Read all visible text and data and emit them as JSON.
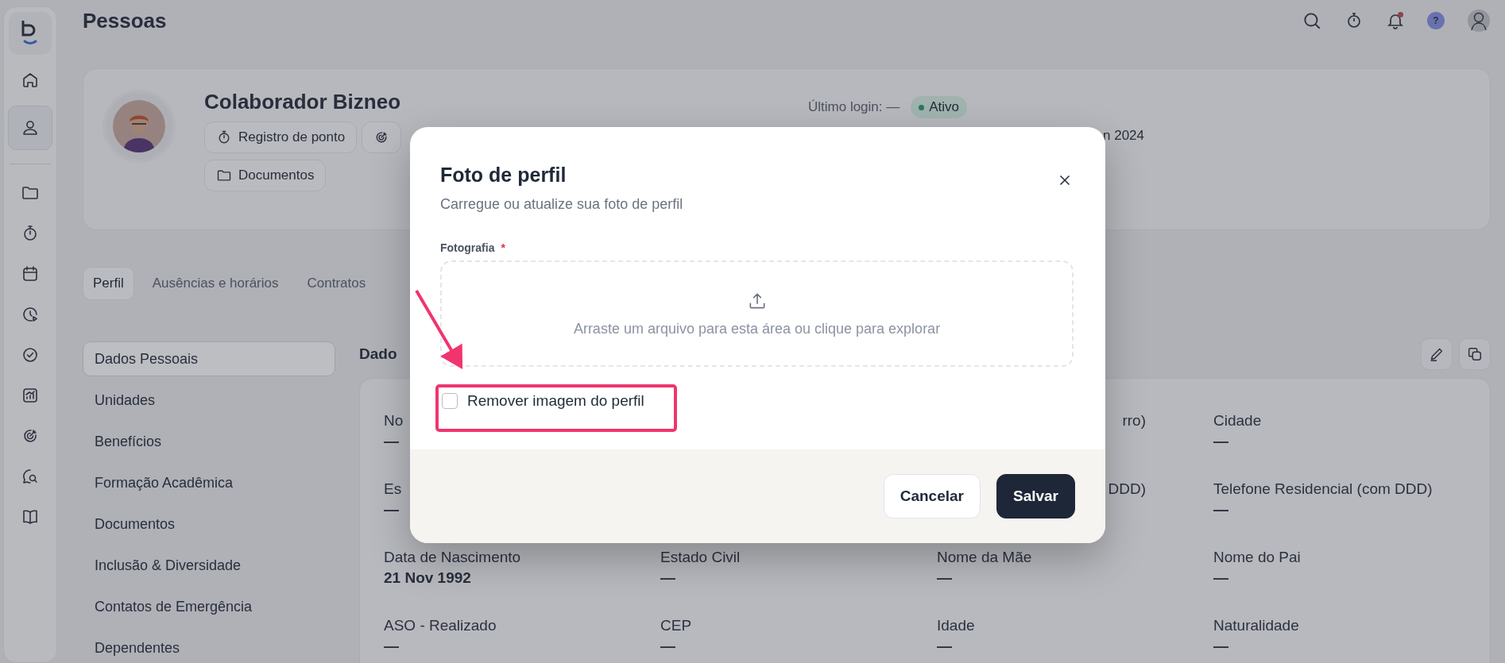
{
  "sidebar": {
    "items": [
      {
        "selected": false
      },
      {
        "selected": true
      },
      {
        "selected": false
      },
      {
        "selected": false
      },
      {
        "selected": false
      },
      {
        "selected": false
      },
      {
        "selected": false
      },
      {
        "selected": false
      },
      {
        "selected": false
      },
      {
        "selected": false
      },
      {
        "selected": false
      }
    ]
  },
  "header": {
    "title": "Pessoas",
    "help": "?",
    "notifications": {
      "unread": true
    }
  },
  "profile": {
    "name": "Colaborador Bizneo",
    "actions": [
      {
        "label": "Registro de ponto",
        "kind": "stopwatch"
      },
      {
        "kind": "target"
      },
      {
        "label": "Documentos",
        "kind": "folder"
      }
    ],
    "last_login": "Último login: —",
    "status": "Ativo",
    "info_fragment": "n 2024"
  },
  "tabs": [
    {
      "label": "Perfil",
      "selected": true
    },
    {
      "label": "Ausências e horários",
      "selected": false
    },
    {
      "label": "Contratos",
      "selected": false
    }
  ],
  "sections": [
    {
      "label": "Dados Pessoais",
      "selected": true
    },
    {
      "label": "Unidades",
      "selected": false
    },
    {
      "label": "Benefícios",
      "selected": false
    },
    {
      "label": "Formação Acadêmica",
      "selected": false
    },
    {
      "label": "Documentos",
      "selected": false
    },
    {
      "label": "Inclusão & Diversidade",
      "selected": false
    },
    {
      "label": "Contatos de Emergência",
      "selected": false
    },
    {
      "label": "Dependentes",
      "selected": false
    }
  ],
  "details": {
    "title": "Dado",
    "rows": [
      {
        "cells": [
          {
            "label": "No",
            "value": "—"
          },
          null,
          {
            "label": "rro)",
            "partial": true
          },
          {
            "label": "Cidade",
            "value": "—"
          }
        ]
      },
      {
        "cells": [
          {
            "label": "Es",
            "value": "—"
          },
          null,
          {
            "label": "DDD)",
            "partial": true
          },
          {
            "label": "Telefone Residencial (com DDD)",
            "value": "—"
          }
        ]
      },
      {
        "cells": [
          {
            "label": "Data de Nascimento",
            "value": "21 Nov 1992"
          },
          {
            "label": "Estado Civil",
            "value": "—"
          },
          {
            "label": "Nome da Mãe",
            "value": "—"
          },
          {
            "label": "Nome do Pai",
            "value": "—"
          }
        ]
      },
      {
        "cells": [
          {
            "label": "ASO - Realizado",
            "value": "—"
          },
          {
            "label": "CEP",
            "value": "—"
          },
          {
            "label": "Idade",
            "value": "—"
          },
          {
            "label": "Naturalidade",
            "value": "—"
          }
        ]
      }
    ]
  },
  "modal": {
    "title": "Foto de perfil",
    "subtitle": "Carregue ou atualize sua foto de perfil",
    "field_label": "Fotografia",
    "required_mark": "*",
    "dropzone_text": "Arraste um arquivo para esta área ou clique para explorar",
    "remove_image": {
      "label": "Remover imagem do perfil",
      "checked": false,
      "highlighted": true
    },
    "buttons": [
      {
        "label": "Cancelar",
        "kind": "secondary"
      },
      {
        "label": "Salvar",
        "kind": "primary"
      }
    ]
  }
}
